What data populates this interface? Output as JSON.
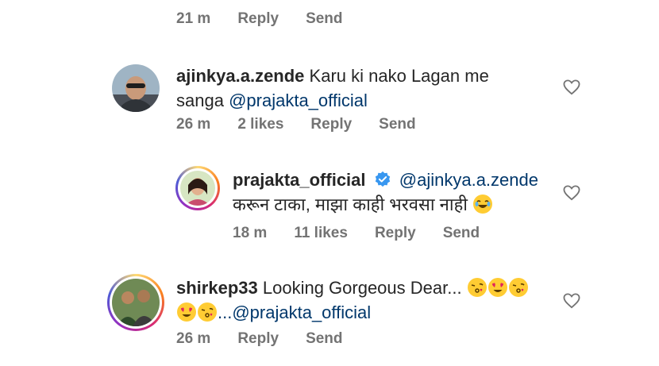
{
  "top_meta": {
    "time": "21 m",
    "reply": "Reply",
    "send": "Send"
  },
  "comments": [
    {
      "username": "ajinkya.a.zende",
      "text_line1": "Karu ki nako Lagan me",
      "text_line2": "sanga",
      "mention": "@prajakta_official",
      "time": "26 m",
      "likes": "2 likes",
      "reply": "Reply",
      "send": "Send"
    },
    {
      "username": "prajakta_official",
      "mention": "@ajinkya.a.zende",
      "text": "करून टाका, माझा काही भरवसा नाही",
      "emoji_icon": "laughing-emoji-icon",
      "time": "18 m",
      "likes": "11 likes",
      "reply": "Reply",
      "send": "Send"
    },
    {
      "username": "shirkep33",
      "text": "Looking Gorgeous Dear...",
      "mention": "...@prajakta_official",
      "time": "26 m",
      "reply": "Reply",
      "send": "Send"
    }
  ],
  "colors": {
    "meta": "#737373",
    "mention": "#00376b",
    "verified": "#3897f0",
    "text": "#262626"
  }
}
